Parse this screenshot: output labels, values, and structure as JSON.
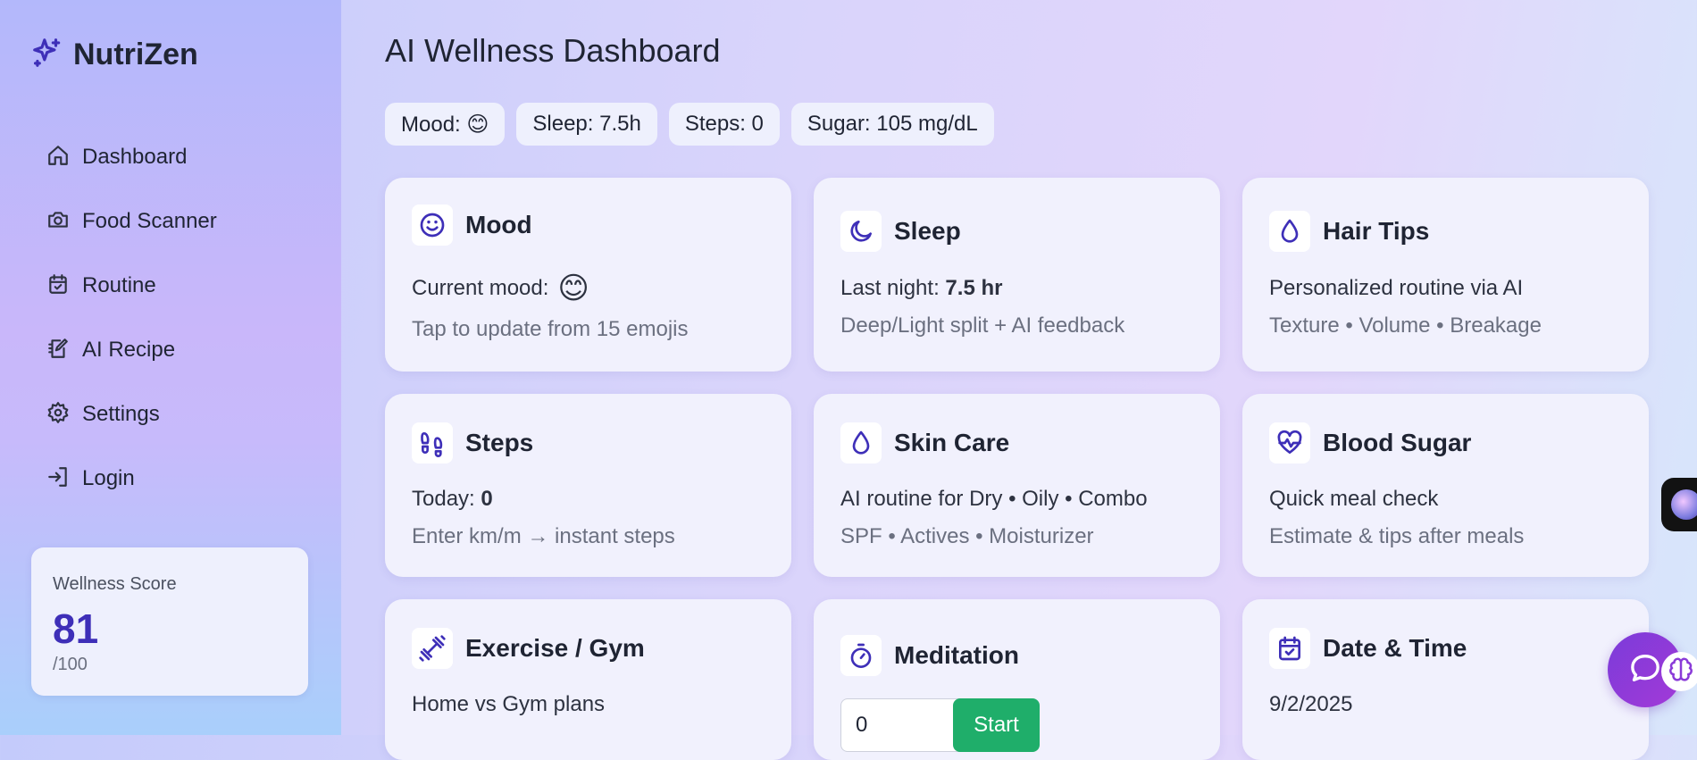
{
  "brand": {
    "name": "NutriZen"
  },
  "sidebar": {
    "items": [
      {
        "label": "Dashboard",
        "icon": "home-icon"
      },
      {
        "label": "Food Scanner",
        "icon": "camera-icon"
      },
      {
        "label": "Routine",
        "icon": "calendar-check-icon"
      },
      {
        "label": "AI Recipe",
        "icon": "notebook-pen-icon"
      },
      {
        "label": "Settings",
        "icon": "gear-icon"
      },
      {
        "label": "Login",
        "icon": "login-icon"
      }
    ]
  },
  "wellness": {
    "label": "Wellness Score",
    "value": "81",
    "max": "/100"
  },
  "main": {
    "title": "AI Wellness Dashboard",
    "chips": [
      {
        "label": "Mood: 😊"
      },
      {
        "label": "Sleep: 7.5h"
      },
      {
        "label": "Steps: 0"
      },
      {
        "label": "Sugar: 105 mg/dL"
      }
    ]
  },
  "cards": {
    "mood": {
      "title": "Mood",
      "line1_prefix": "Current mood:",
      "emoji": "😊",
      "line2": "Tap to update from 15 emojis",
      "icon": "smile-icon"
    },
    "sleep": {
      "title": "Sleep",
      "line1_prefix": "Last night:",
      "line1_value": "7.5 hr",
      "line2": "Deep/Light split + AI feedback",
      "icon": "moon-icon"
    },
    "hair": {
      "title": "Hair Tips",
      "line1": "Personalized routine via AI",
      "line2": "Texture • Volume • Breakage",
      "icon": "droplet-icon"
    },
    "steps": {
      "title": "Steps",
      "line1_prefix": "Today:",
      "line1_value": "0",
      "line2": "Enter km/m → instant steps",
      "icon": "footprints-icon"
    },
    "skin": {
      "title": "Skin Care",
      "line1": "AI routine for Dry • Oily • Combo",
      "line2": "SPF • Actives • Moisturizer",
      "icon": "droplet-icon"
    },
    "sugar": {
      "title": "Blood Sugar",
      "line1": "Quick meal check",
      "line2": "Estimate & tips after meals",
      "icon": "heart-pulse-icon"
    },
    "exercise": {
      "title": "Exercise / Gym",
      "line1": "Home vs Gym plans",
      "icon": "dumbbell-icon"
    },
    "meditation": {
      "title": "Meditation",
      "input_value": "0",
      "start_label": "Start",
      "icon": "timer-icon"
    },
    "datetime": {
      "title": "Date & Time",
      "line1": "9/2/2025",
      "icon": "calendar-icon"
    }
  },
  "colors": {
    "accent": "#3e2fb8",
    "start": "#1fae6a",
    "fab": "#8a3bd8"
  }
}
